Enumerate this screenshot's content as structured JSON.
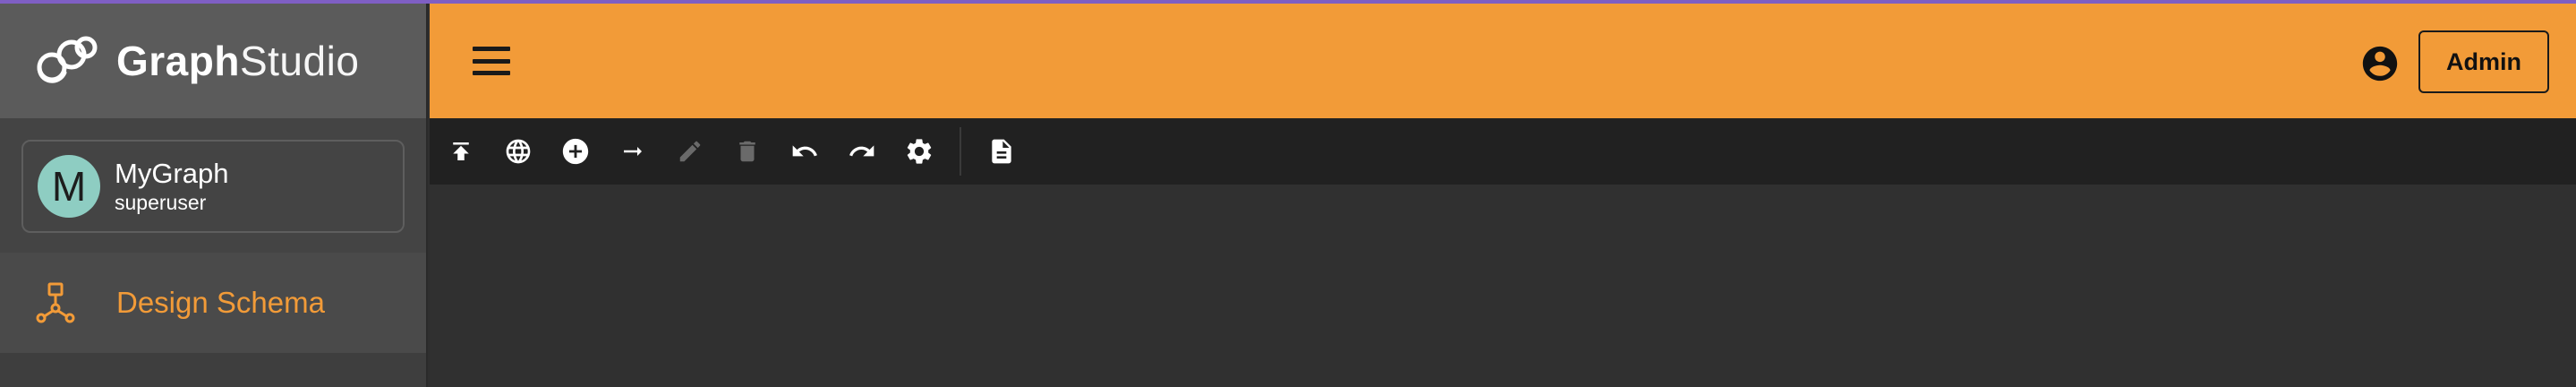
{
  "brand": {
    "name_part1": "Graph",
    "name_part2": "Studio",
    "logo_icon": "graphstudio-logo-icon"
  },
  "graph_card": {
    "avatar_letter": "M",
    "name": "MyGraph",
    "role": "superuser"
  },
  "nav": [
    {
      "label": "Design Schema",
      "icon": "schema-icon",
      "active": true
    }
  ],
  "header": {
    "menu_icon": "menu-icon",
    "account_icon": "account-circle-icon",
    "admin_label": "Admin"
  },
  "toolbar": {
    "buttons": [
      {
        "name": "upload-icon",
        "enabled": true
      },
      {
        "name": "globe-icon",
        "enabled": true
      },
      {
        "name": "add-vertex-icon",
        "enabled": true
      },
      {
        "name": "add-edge-icon",
        "enabled": true
      },
      {
        "name": "edit-icon",
        "enabled": false
      },
      {
        "name": "delete-icon",
        "enabled": false
      },
      {
        "name": "undo-icon",
        "enabled": true
      },
      {
        "name": "redo-icon",
        "enabled": true
      },
      {
        "name": "settings-icon",
        "enabled": true
      },
      {
        "name": "document-icon",
        "enabled": true
      }
    ]
  },
  "colors": {
    "accent": "#f29b38",
    "top_border": "#7f5fc4",
    "sidebar": "#3c3c3c",
    "toolbar": "#212121",
    "canvas": "#303030"
  }
}
